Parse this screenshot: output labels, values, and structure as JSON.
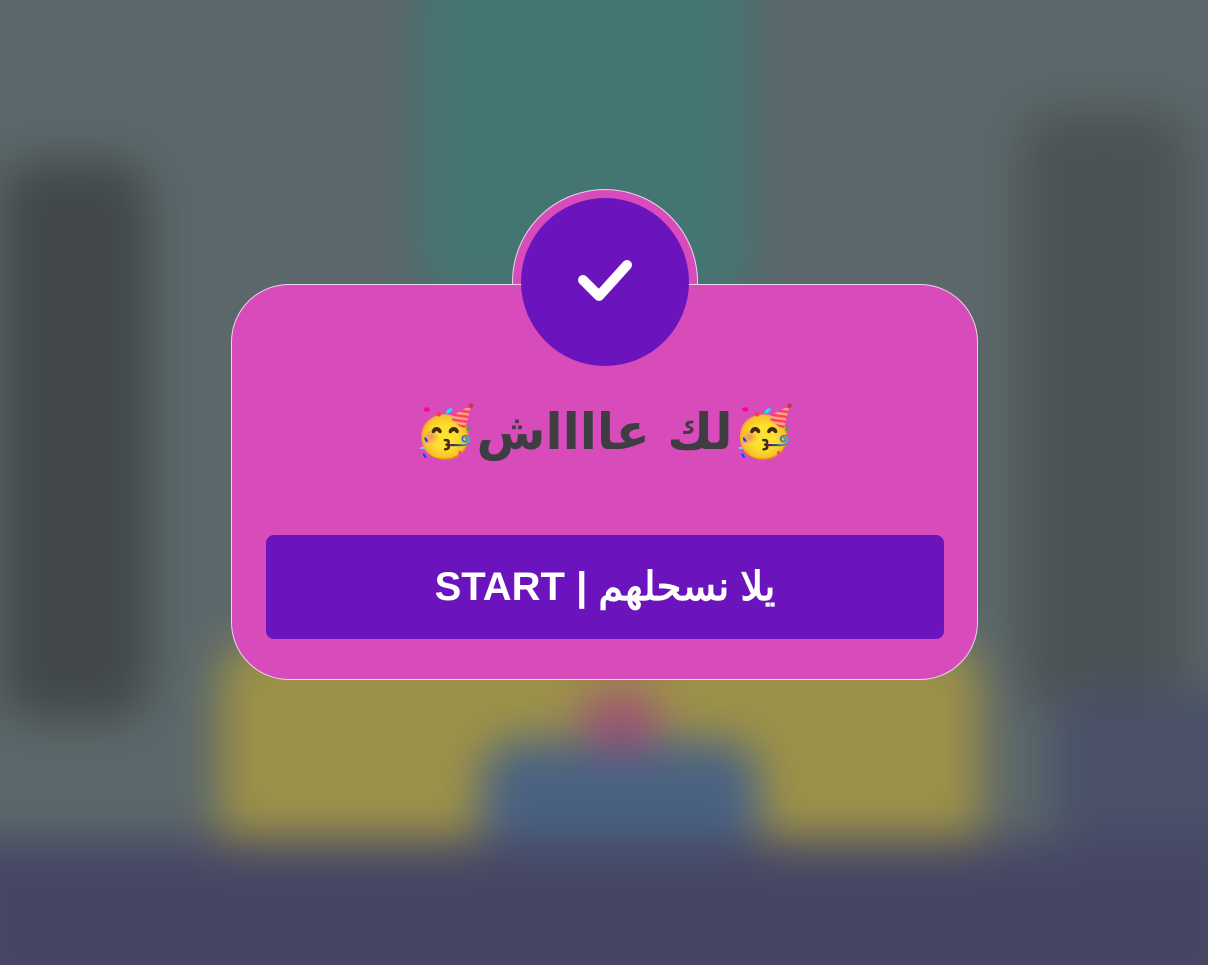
{
  "dialog": {
    "title": "🥳لك عااااش🥳",
    "status_icon": "checkmark-icon",
    "start_button_label": "يلا نسحلهم | START"
  },
  "colors": {
    "dialog_background": "#d74bbb",
    "badge_background": "#6b14bd",
    "button_background": "#6b14bd",
    "title_text": "#3d3d42",
    "button_text": "#ffffff"
  }
}
